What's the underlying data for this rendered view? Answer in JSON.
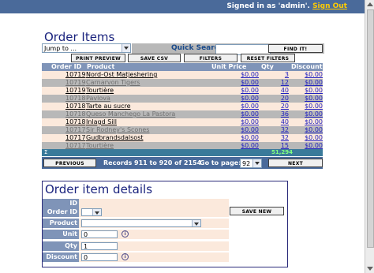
{
  "top": {
    "signed_in": "Signed in as 'admin'.",
    "sign_out": "Sign Out"
  },
  "list": {
    "title": "Order Items",
    "jump_to": "Jump to ...",
    "quick_search_label": "Quick Search",
    "find_button": "FIND IT!",
    "print_button": "PRINT PREVIEW",
    "csv_button": "SAVE CSV",
    "filters_button": "FILTERS",
    "reset_button": "RESET FILTERS",
    "columns": [
      "Order ID",
      "Product",
      "Unit Price",
      "Qty",
      "Discount"
    ],
    "rows": [
      {
        "order": "10719",
        "product": "Nord-Ost Matjeshering",
        "price": "$0.00",
        "qty": "3",
        "discount": "$0.00",
        "muted": false
      },
      {
        "order": "10719",
        "product": "Carnarvon Tigers",
        "price": "$0.00",
        "qty": "12",
        "discount": "$0.00",
        "muted": true
      },
      {
        "order": "10719",
        "product": "Tourtière",
        "price": "$0.00",
        "qty": "40",
        "discount": "$0.00",
        "muted": false
      },
      {
        "order": "10718",
        "product": "Pavlova",
        "price": "$0.00",
        "qty": "20",
        "discount": "$0.00",
        "muted": true
      },
      {
        "order": "10718",
        "product": "Tarte au sucre",
        "price": "$0.00",
        "qty": "20",
        "discount": "$0.00",
        "muted": false
      },
      {
        "order": "10718",
        "product": "Queso Manchego La Pastora",
        "price": "$0.00",
        "qty": "36",
        "discount": "$0.00",
        "muted": true
      },
      {
        "order": "10718",
        "product": "Inlagd Sill",
        "price": "$0.00",
        "qty": "40",
        "discount": "$0.00",
        "muted": false
      },
      {
        "order": "10717",
        "product": "Sir Rodney's Scones",
        "price": "$0.00",
        "qty": "32",
        "discount": "$0.00",
        "muted": true
      },
      {
        "order": "10717",
        "product": "Gudbrandsdalsost",
        "price": "$0.00",
        "qty": "32",
        "discount": "$0.00",
        "muted": false
      },
      {
        "order": "10717",
        "product": "Tourtière",
        "price": "$0.00",
        "qty": "15",
        "discount": "$0.00",
        "muted": true
      }
    ],
    "totals_mark": "Σ",
    "qty_total": "51,294",
    "previous_button": "PREVIOUS",
    "records_text": "Records 911 to 920 of 2154",
    "go_to_page": "Go to page:",
    "page_value": "92",
    "next_button": "NEXT"
  },
  "detail": {
    "title": "Order item details",
    "labels": {
      "id": "ID",
      "order_id": "Order ID",
      "product": "Product",
      "unit_price": "Unit Price",
      "qty": "Qty",
      "discount": "Discount"
    },
    "values": {
      "unit_price": "0",
      "qty": "1",
      "discount": "0"
    },
    "save_button": "SAVE NEW",
    "info_glyph": "i"
  },
  "colors": {
    "header_bg": "#7f94b8",
    "row_light": "#fbe9dc",
    "row_alt": "#b8b8b8",
    "title": "#1a237e",
    "topbar": "#4a6a9a"
  },
  "icons": [
    "dropdown-arrow-icon",
    "info-icon",
    "scroll-up-icon",
    "scroll-down-icon"
  ]
}
